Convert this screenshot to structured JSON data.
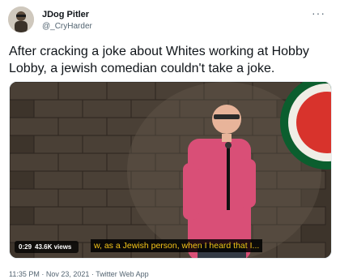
{
  "user": {
    "display_name": "JDog Pitler",
    "handle": "@_CryHarder"
  },
  "more_icon": "more-horizontal-icon",
  "tweet_text": "After cracking a joke about Whites working at Hobby Lobby, a jewish comedian couldn't take a joke.",
  "video": {
    "elapsed": "0:29",
    "views": "43.6K views",
    "caption": "w, as a Jewish person, when I heard that I..."
  },
  "footer": {
    "timestamp": "11:35 PM · Nov 23, 2021 · Twitter Web App"
  },
  "colors": {
    "caption_text": "#f5c518",
    "name": "#0f1419",
    "secondary_text": "#536471"
  }
}
